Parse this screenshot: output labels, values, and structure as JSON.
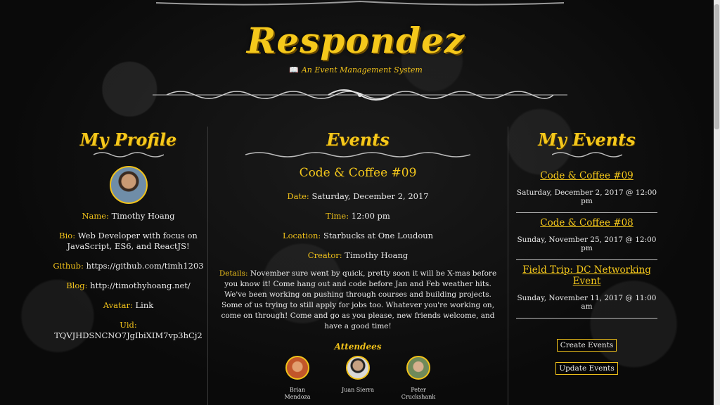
{
  "header": {
    "title": "Respondez",
    "subtitle": "An Event Management System"
  },
  "profile": {
    "title": "My Profile",
    "name_label": "Name:",
    "name": "Timothy Hoang",
    "bio_label": "Bio:",
    "bio": "Web Developer with focus on JavaScript, ES6, and ReactJS!",
    "github_label": "Github:",
    "github": "https://github.com/timh1203",
    "blog_label": "Blog:",
    "blog": "http://timothyhoang.net/",
    "avatar_label": "Avatar:",
    "avatar": "Link",
    "uid_label": "Uid:",
    "uid": "TQVJHDSNCNO7JgIbiXIM7vp3hCj2"
  },
  "events": {
    "title": "Events",
    "event_title": "Code & Coffee #09",
    "date_label": "Date:",
    "date": "Saturday, December 2, 2017",
    "time_label": "Time:",
    "time": "12:00 pm",
    "location_label": "Location:",
    "location": "Starbucks at One Loudoun",
    "creator_label": "Creator:",
    "creator": "Timothy Hoang",
    "details_label": "Details:",
    "details": "November sure went by quick, pretty soon it will be X-mas before you know it! Come hang out and code before Jan and Feb weather hits. We've been working on pushing through courses and building projects. Some of us trying to still apply for jobs too. Whatever you're working on, come on through! Come and go as you please, new friends welcome, and have a good time!",
    "attendees_label": "Attendees",
    "attendees": [
      {
        "name": "Brian Mendoza",
        "color": "#c2562a"
      },
      {
        "name": "Juan Sierra",
        "color": "#6b5a4a"
      },
      {
        "name": "Peter Cruckshank",
        "color": "#8fa070"
      }
    ]
  },
  "my_events": {
    "title": "My Events",
    "items": [
      {
        "title": "Code & Coffee #09",
        "date": "Saturday, December 2, 2017 @ 12:00 pm"
      },
      {
        "title": "Code & Coffee #08",
        "date": "Sunday, November 25, 2017 @ 12:00 pm"
      },
      {
        "title": "Field Trip: DC Networking Event",
        "date": "Sunday, November 11, 2017 @ 11:00 am"
      }
    ],
    "create_button": "Create Events",
    "update_button": "Update Events"
  },
  "colors": {
    "accent": "#f1c21a",
    "background": "#0c0c0c"
  }
}
